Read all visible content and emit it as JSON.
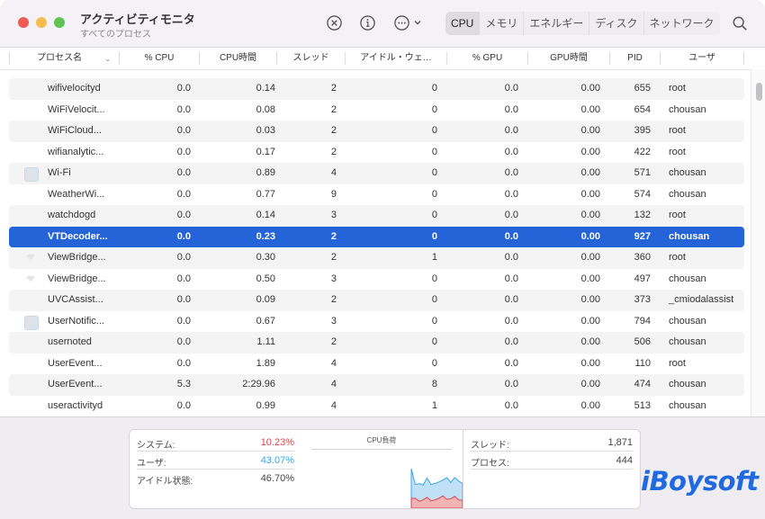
{
  "window": {
    "title": "アクティビティモニタ",
    "subtitle": "すべてのプロセス"
  },
  "toolbar": {
    "stop_icon": "x-circle-icon",
    "info_icon": "info-icon",
    "more_icon": "ellipsis-circle-icon",
    "search_icon": "search-icon",
    "tabs": [
      {
        "label": "CPU",
        "active": true
      },
      {
        "label": "メモリ",
        "active": false
      },
      {
        "label": "エネルギー",
        "active": false
      },
      {
        "label": "ディスク",
        "active": false
      },
      {
        "label": "ネットワーク",
        "active": false
      }
    ]
  },
  "columns": {
    "name": "プロセス名",
    "cpu": "% CPU",
    "cpu_time": "CPU時間",
    "threads": "スレッド",
    "idle_wake": "アイドル・ウェ…",
    "gpu": "% GPU",
    "gpu_time": "GPU時間",
    "pid": "PID",
    "user": "ユーザ"
  },
  "rows": [
    {
      "name": "wifivelocityd",
      "cpu": "0.0",
      "cpu_time": "0.14",
      "threads": "2",
      "idle": "0",
      "gpu": "0.0",
      "gpu_time": "0.00",
      "pid": "655",
      "user": "root",
      "icon": ""
    },
    {
      "name": "WiFiVelocit...",
      "cpu": "0.0",
      "cpu_time": "0.08",
      "threads": "2",
      "idle": "0",
      "gpu": "0.0",
      "gpu_time": "0.00",
      "pid": "654",
      "user": "chousan",
      "icon": ""
    },
    {
      "name": "WiFiCloud...",
      "cpu": "0.0",
      "cpu_time": "0.03",
      "threads": "2",
      "idle": "0",
      "gpu": "0.0",
      "gpu_time": "0.00",
      "pid": "395",
      "user": "root",
      "icon": ""
    },
    {
      "name": "wifianalytic...",
      "cpu": "0.0",
      "cpu_time": "0.17",
      "threads": "2",
      "idle": "0",
      "gpu": "0.0",
      "gpu_time": "0.00",
      "pid": "422",
      "user": "root",
      "icon": ""
    },
    {
      "name": "Wi-Fi",
      "cpu": "0.0",
      "cpu_time": "0.89",
      "threads": "4",
      "idle": "0",
      "gpu": "0.0",
      "gpu_time": "0.00",
      "pid": "571",
      "user": "chousan",
      "icon": "app-icon"
    },
    {
      "name": "WeatherWi...",
      "cpu": "0.0",
      "cpu_time": "0.77",
      "threads": "9",
      "idle": "0",
      "gpu": "0.0",
      "gpu_time": "0.00",
      "pid": "574",
      "user": "chousan",
      "icon": ""
    },
    {
      "name": "watchdogd",
      "cpu": "0.0",
      "cpu_time": "0.14",
      "threads": "3",
      "idle": "0",
      "gpu": "0.0",
      "gpu_time": "0.00",
      "pid": "132",
      "user": "root",
      "icon": ""
    },
    {
      "name": "VTDecoder...",
      "cpu": "0.0",
      "cpu_time": "0.23",
      "threads": "2",
      "idle": "0",
      "gpu": "0.0",
      "gpu_time": "0.00",
      "pid": "927",
      "user": "chousan",
      "icon": "",
      "selected": true
    },
    {
      "name": "ViewBridge...",
      "cpu": "0.0",
      "cpu_time": "0.30",
      "threads": "2",
      "idle": "1",
      "gpu": "0.0",
      "gpu_time": "0.00",
      "pid": "360",
      "user": "root",
      "icon": "shield-icon"
    },
    {
      "name": "ViewBridge...",
      "cpu": "0.0",
      "cpu_time": "0.50",
      "threads": "3",
      "idle": "0",
      "gpu": "0.0",
      "gpu_time": "0.00",
      "pid": "497",
      "user": "chousan",
      "icon": "shield-icon"
    },
    {
      "name": "UVCAssist...",
      "cpu": "0.0",
      "cpu_time": "0.09",
      "threads": "2",
      "idle": "0",
      "gpu": "0.0",
      "gpu_time": "0.00",
      "pid": "373",
      "user": "_cmiodalassist",
      "icon": ""
    },
    {
      "name": "UserNotific...",
      "cpu": "0.0",
      "cpu_time": "0.67",
      "threads": "3",
      "idle": "0",
      "gpu": "0.0",
      "gpu_time": "0.00",
      "pid": "794",
      "user": "chousan",
      "icon": "app-icon"
    },
    {
      "name": "usernoted",
      "cpu": "0.0",
      "cpu_time": "1.11",
      "threads": "2",
      "idle": "0",
      "gpu": "0.0",
      "gpu_time": "0.00",
      "pid": "506",
      "user": "chousan",
      "icon": ""
    },
    {
      "name": "UserEvent...",
      "cpu": "0.0",
      "cpu_time": "1.89",
      "threads": "4",
      "idle": "0",
      "gpu": "0.0",
      "gpu_time": "0.00",
      "pid": "110",
      "user": "root",
      "icon": ""
    },
    {
      "name": "UserEvent...",
      "cpu": "5.3",
      "cpu_time": "2:29.96",
      "threads": "4",
      "idle": "8",
      "gpu": "0.0",
      "gpu_time": "0.00",
      "pid": "474",
      "user": "chousan",
      "icon": ""
    },
    {
      "name": "useractivityd",
      "cpu": "0.0",
      "cpu_time": "0.99",
      "threads": "4",
      "idle": "1",
      "gpu": "0.0",
      "gpu_time": "0.00",
      "pid": "513",
      "user": "chousan",
      "icon": ""
    }
  ],
  "summary": {
    "system_label": "システム:",
    "system_value": "10.23%",
    "user_label": "ユーザ:",
    "user_value": "43.07%",
    "idle_label": "アイドル状態:",
    "idle_value": "46.70%",
    "chart_title": "CPU負荷",
    "threads_label": "スレッド:",
    "threads_value": "1,871",
    "processes_label": "プロセス:",
    "processes_value": "444"
  },
  "colors": {
    "system": "#e0434a",
    "user": "#38a6e8",
    "selection": "#2463d8",
    "brand": "#1f6ae0"
  },
  "cpu_load": {
    "user": [
      0.8,
      0.48,
      0.5,
      0.47,
      0.61,
      0.48,
      0.5,
      0.53,
      0.57,
      0.62,
      0.52,
      0.62,
      0.55,
      0.5
    ],
    "system": [
      0.2,
      0.2,
      0.14,
      0.17,
      0.22,
      0.15,
      0.17,
      0.2,
      0.25,
      0.18,
      0.19,
      0.24,
      0.17,
      0.16
    ]
  },
  "watermark": "iBoysoft"
}
